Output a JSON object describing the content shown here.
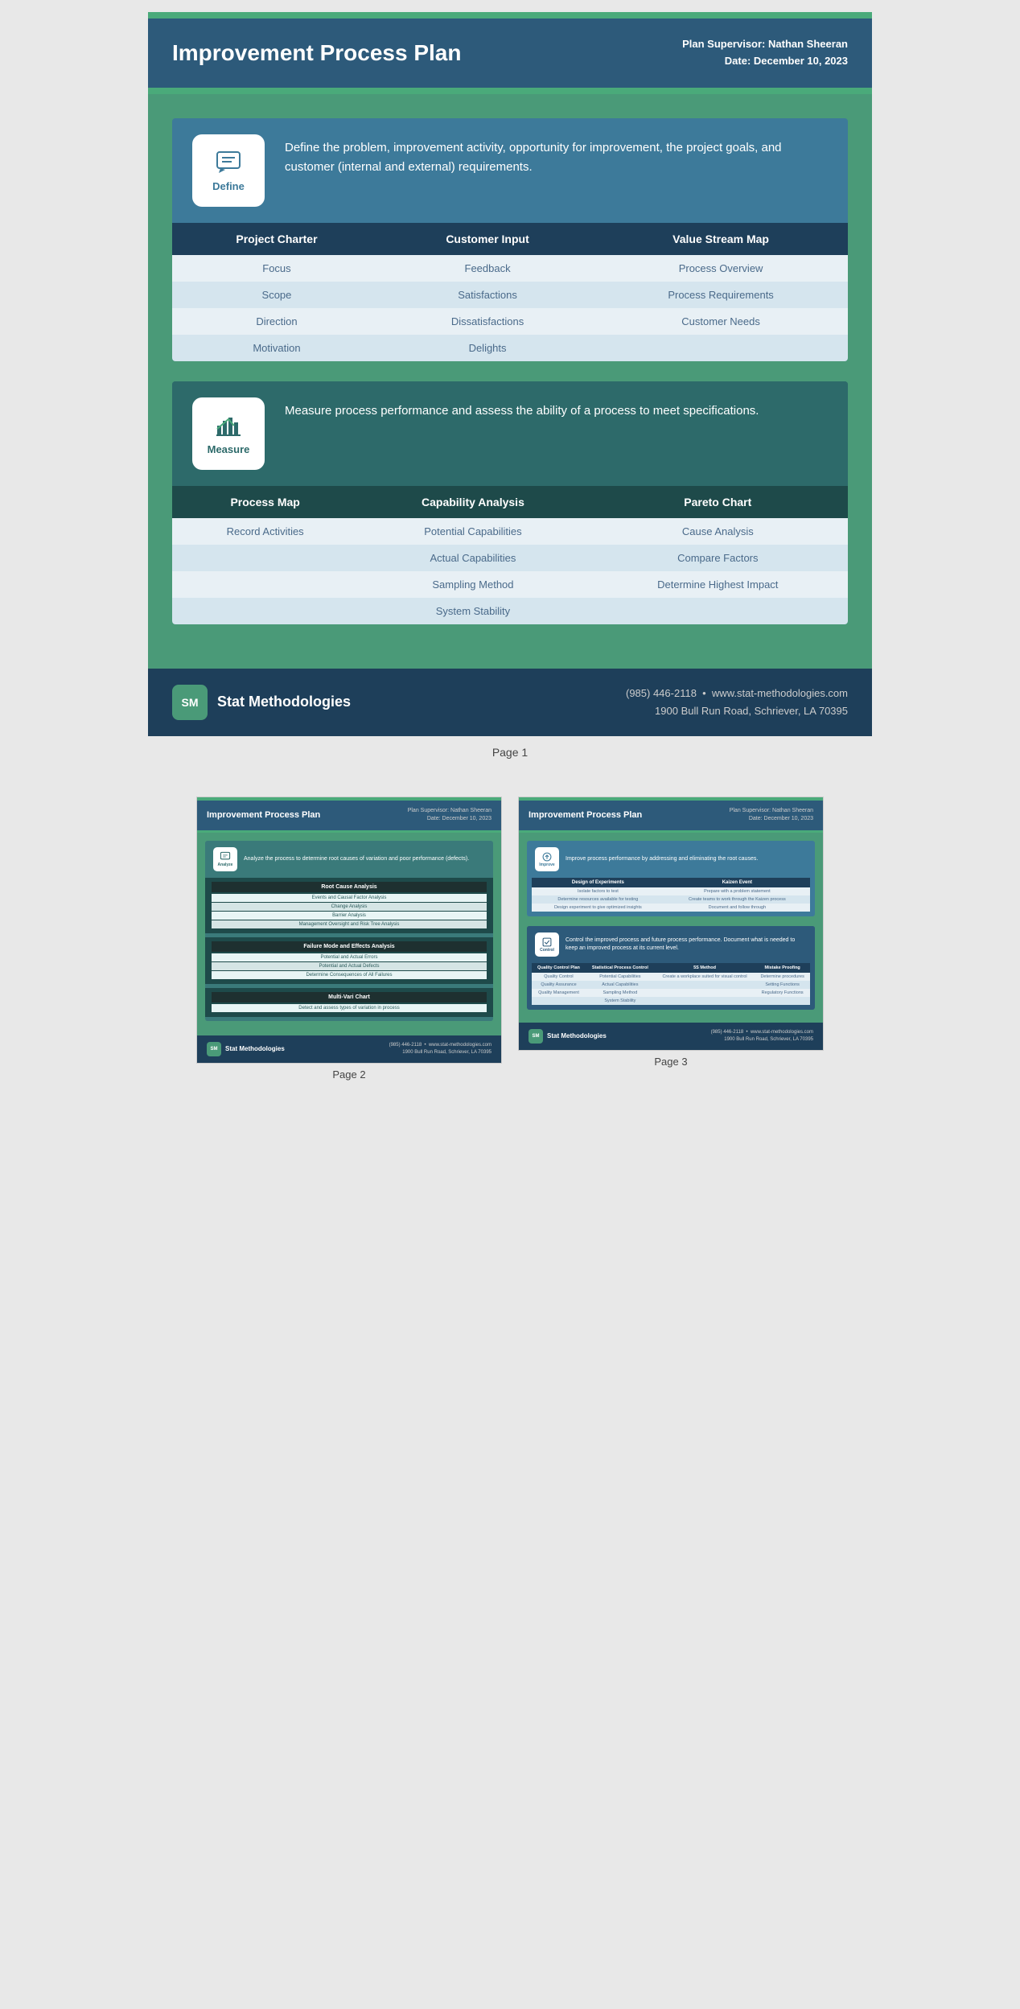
{
  "page1": {
    "accent_color": "#4aaa7a",
    "header": {
      "title": "Improvement Process Plan",
      "supervisor_label": "Plan Supervisor:",
      "supervisor_name": "Nathan Sheeran",
      "date_label": "Date:",
      "date_value": "December 10, 2023"
    },
    "define_section": {
      "icon_label": "Define",
      "description": "Define the problem, improvement activity, opportunity for improvement, the project goals, and customer (internal and external) requirements.",
      "table": {
        "columns": [
          "Project Charter",
          "Customer Input",
          "Value Stream Map"
        ],
        "rows": [
          [
            "Focus",
            "Feedback",
            "Process Overview"
          ],
          [
            "Scope",
            "Satisfactions",
            "Process Requirements"
          ],
          [
            "Direction",
            "Dissatisfactions",
            "Customer Needs"
          ],
          [
            "Motivation",
            "Delights",
            ""
          ]
        ]
      }
    },
    "measure_section": {
      "icon_label": "Measure",
      "description": "Measure process performance and assess the ability of a process to meet specifications.",
      "table": {
        "columns": [
          "Process Map",
          "Capability Analysis",
          "Pareto Chart"
        ],
        "rows": [
          [
            "Record Activities",
            "Potential Capabilities",
            "Cause Analysis"
          ],
          [
            "",
            "Actual Capabilities",
            "Compare Factors"
          ],
          [
            "",
            "Sampling Method",
            "Determine Highest Impact"
          ],
          [
            "",
            "System Stability",
            ""
          ]
        ]
      }
    },
    "footer": {
      "logo_text": "SM",
      "brand_name": "Stat Methodologies",
      "phone": "(985) 446-2118",
      "website": "www.stat-methodologies.com",
      "address": "1900 Bull Run Road, Schriever, LA 70395"
    },
    "page_label": "Page 1"
  },
  "page2": {
    "header": {
      "title": "Improvement Process Plan",
      "supervisor_label": "Plan Supervisor:",
      "supervisor_name": "Nathan Sheeran",
      "date_label": "Date:",
      "date_value": "December 10, 2023"
    },
    "analyze_section": {
      "icon_label": "Analyze",
      "description": "Analyze the process to determine root causes of variation and poor performance (defects).",
      "tables": [
        {
          "title": "Root Cause Analysis",
          "rows": [
            "Events and Causal Factor Analysis",
            "Change Analysis",
            "Barrier Analysis",
            "Management Oversight and Risk Tree Analysis"
          ]
        },
        {
          "title": "Failure Mode and Effects Analysis",
          "rows": [
            "Potential and Actual Errors",
            "Potential and Actual Defects",
            "Determine Consequences of All Failures"
          ]
        },
        {
          "title": "Multi-Vari Chart",
          "rows": [
            "Detect and assess types of variation in process"
          ]
        }
      ]
    },
    "footer": {
      "logo_text": "SM",
      "brand_name": "Stat Methodologies",
      "phone": "(985) 446-2118",
      "website": "www.stat-methodologies.com",
      "address": "1900 Bull Run Road, Schriever, LA 70395"
    },
    "page_label": "Page 2"
  },
  "page3": {
    "header": {
      "title": "Improvement Process Plan",
      "supervisor_label": "Plan Supervisor:",
      "supervisor_name": "Nathan Sheeran",
      "date_label": "Date:",
      "date_value": "December 10, 2023"
    },
    "improve_section": {
      "icon_label": "Improve",
      "description": "Improve process performance by addressing and eliminating the root causes.",
      "table": {
        "columns": [
          "Design of Experiments",
          "Kaizen Event"
        ],
        "rows": [
          [
            "Isolate factors to test",
            "Prepare with a problem statement"
          ],
          [
            "Determine resources available for testing",
            "Create teams to work through the Kaizen process"
          ],
          [
            "Design experiment to give optimized insights",
            "Document and follow through"
          ]
        ]
      }
    },
    "control_section": {
      "icon_label": "Control",
      "description": "Control the improved process and future process performance. Document what is needed to keep an improved process at its current level.",
      "table": {
        "columns": [
          "Quality Control Plan",
          "Statistical Process Control",
          "5S Method",
          "Mistake Proofing"
        ],
        "rows": [
          [
            "Quality Control",
            "Potential Capabilities",
            "Create a workplace suited for visual control",
            "Determine procedures"
          ],
          [
            "Quality Assurance",
            "Actual Capabilities",
            "",
            "Setting Functions"
          ],
          [
            "Quality Management",
            "Sampling Method",
            "",
            "Regulatory Functions"
          ],
          [
            "",
            "System Stability",
            "",
            ""
          ]
        ]
      }
    },
    "footer": {
      "logo_text": "SM",
      "brand_name": "Stat Methodologies",
      "phone": "(985) 446-2118",
      "website": "www.stat-methodologies.com",
      "address": "1900 Bull Run Road, Schriever, LA 70395"
    },
    "page_label": "Page 3"
  }
}
